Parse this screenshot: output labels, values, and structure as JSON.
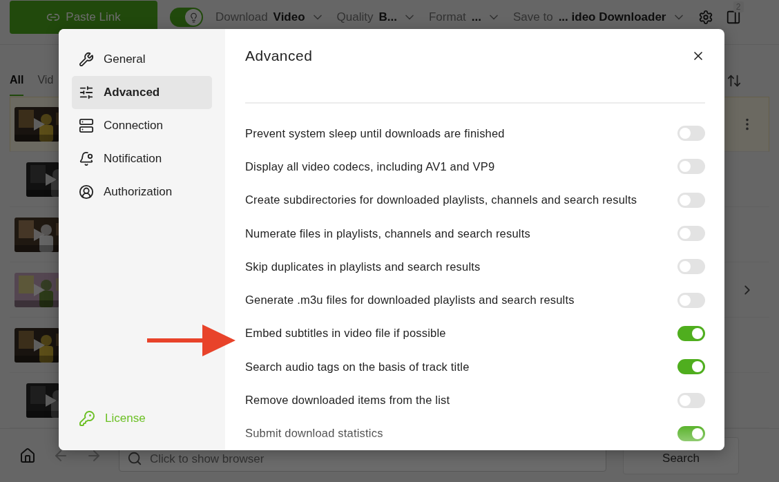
{
  "toolbar": {
    "paste_button": "Paste Link",
    "smart_mode_on": true,
    "download_label": "Download",
    "download_value": "Video",
    "quality_label": "Quality",
    "quality_value": "B...",
    "format_label": "Format",
    "format_value": "...",
    "save_label": "Save to",
    "save_value": "... ideo Downloader",
    "badge": "2"
  },
  "tabs": [
    {
      "label": "All",
      "selected": true
    },
    {
      "label": "Vid",
      "selected": false
    }
  ],
  "items": [
    {
      "selected": true,
      "children": [
        {
          "selected": false
        }
      ]
    },
    {
      "selected": false
    },
    {
      "selected": false,
      "expandable": true
    },
    {
      "selected": false,
      "children": [
        {
          "selected": false
        }
      ]
    }
  ],
  "bottom_bar": {
    "search_placeholder": "Click to show browser",
    "search_button": "Search"
  },
  "dialog": {
    "sidebar": [
      {
        "label": "General",
        "selected": false
      },
      {
        "label": "Advanced",
        "selected": true
      },
      {
        "label": "Connection",
        "selected": false
      },
      {
        "label": "Notification",
        "selected": false
      },
      {
        "label": "Authorization",
        "selected": false
      }
    ],
    "license": "License",
    "title": "Advanced",
    "settings": [
      {
        "label": "Prevent system sleep until downloads are finished",
        "on": false
      },
      {
        "label": "Display all video codecs, including AV1 and VP9",
        "on": false
      },
      {
        "label": "Create subdirectories for downloaded playlists, channels and search results",
        "on": false
      },
      {
        "label": "Numerate files in playlists, channels and search results",
        "on": false
      },
      {
        "label": "Skip duplicates in playlists and search results",
        "on": false
      },
      {
        "label": "Generate .m3u files for downloaded playlists and search results",
        "on": false
      },
      {
        "label": "Embed subtitles in video file if possible",
        "on": true
      },
      {
        "label": "Search audio tags on the basis of track title",
        "on": true
      },
      {
        "label": "Remove downloaded items from the list",
        "on": false
      },
      {
        "label": "Submit download statistics",
        "on": true
      }
    ]
  }
}
